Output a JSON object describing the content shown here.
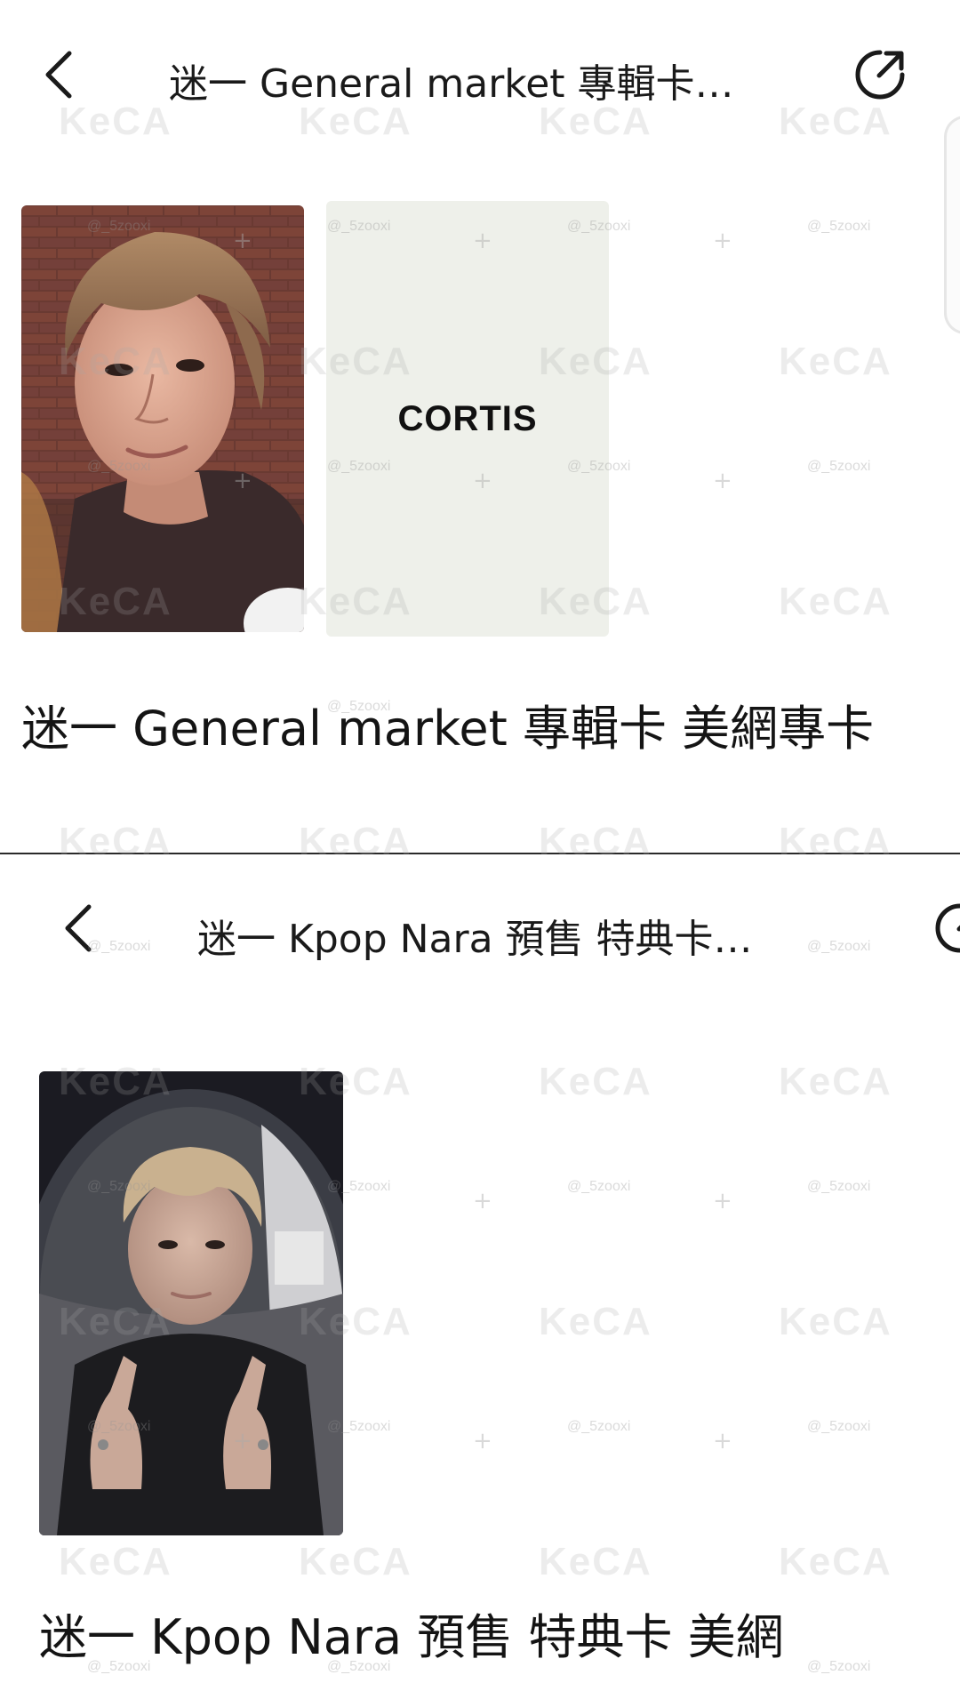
{
  "screen_top": {
    "back_icon": "chevron-left-icon",
    "title": "迷一 General market 專輯卡…",
    "share_icon": "share-external-icon",
    "cards": [
      {
        "type": "photo",
        "subject": "portrait-photo-brick-wall"
      },
      {
        "type": "brand-back",
        "brand_text": "CORTIS"
      }
    ],
    "product_title": "迷一 General market 專輯卡 美網專卡"
  },
  "screen_bottom": {
    "back_icon": "chevron-left-icon",
    "title": "迷一 Kpop Nara 預售 特典卡…",
    "share_icon": "share-external-icon",
    "cards": [
      {
        "type": "photo",
        "subject": "portrait-photo-night-fisheye"
      }
    ],
    "product_title": "迷一 Kpop Nara 預售 特典卡 美網"
  },
  "watermark": {
    "logo_text": "KeCA",
    "handle_text": "@_5zooxi"
  },
  "colors": {
    "background": "#ffffff",
    "text": "#141414",
    "divider": "#2a2a2a",
    "card_back": "#eef0ea"
  }
}
